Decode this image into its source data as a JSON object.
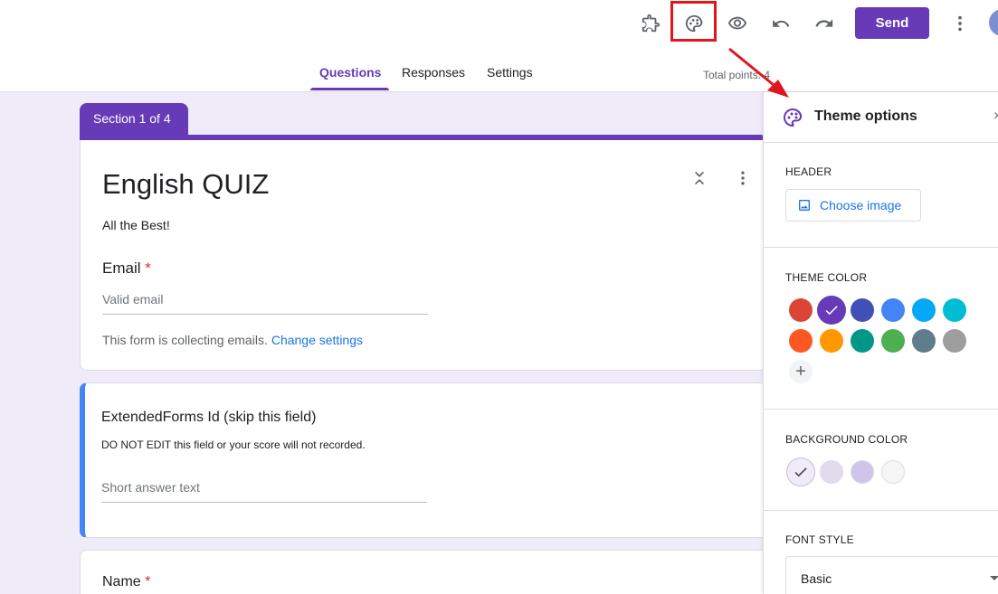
{
  "toolbar": {
    "send_label": "Send",
    "icons": [
      "puzzle-icon",
      "palette-icon",
      "eye-icon",
      "undo-icon",
      "redo-icon",
      "more-vert-icon"
    ]
  },
  "tabs": [
    {
      "label": "Questions",
      "active": true
    },
    {
      "label": "Responses",
      "active": false
    },
    {
      "label": "Settings",
      "active": false
    }
  ],
  "total_points": "Total points: 4",
  "section_tab": "Section 1 of 4",
  "form": {
    "title": "English QUIZ",
    "description": "All the Best!",
    "email_question": "Email",
    "email_placeholder": "Valid email",
    "collecting_note": "This form is collecting emails.",
    "change_settings": "Change settings"
  },
  "question2": {
    "title": "ExtendedForms Id (skip this field)",
    "description": "DO NOT EDIT this field or your score will not recorded.",
    "placeholder": "Short answer text"
  },
  "question3": {
    "title": "Name"
  },
  "required_mark": "*",
  "theme_panel": {
    "title": "Theme options",
    "close_label": "×",
    "header_label": "HEADER",
    "choose_image": "Choose image",
    "theme_color_label": "THEME COLOR",
    "theme_colors": [
      "#db4437",
      "#673ab7",
      "#3f51b5",
      "#4285f4",
      "#03a9f4",
      "#00bcd4",
      "#ff5722",
      "#ff9800",
      "#009688",
      "#4caf50",
      "#607d8b",
      "#9e9e9e"
    ],
    "selected_theme_color": "#673ab7",
    "add_color_label": "+",
    "background_color_label": "BACKGROUND COLOR",
    "background_colors": [
      "#f0ebf8",
      "#e1dbf0",
      "#d1c4e9",
      "#f6f6f6"
    ],
    "selected_background": "#f0ebf8",
    "font_style_label": "FONT STYLE",
    "font_style_value": "Basic"
  },
  "colors": {
    "accent": "#673ab7",
    "highlight": "#e0161d",
    "page_bg": "#f0ebf8"
  }
}
